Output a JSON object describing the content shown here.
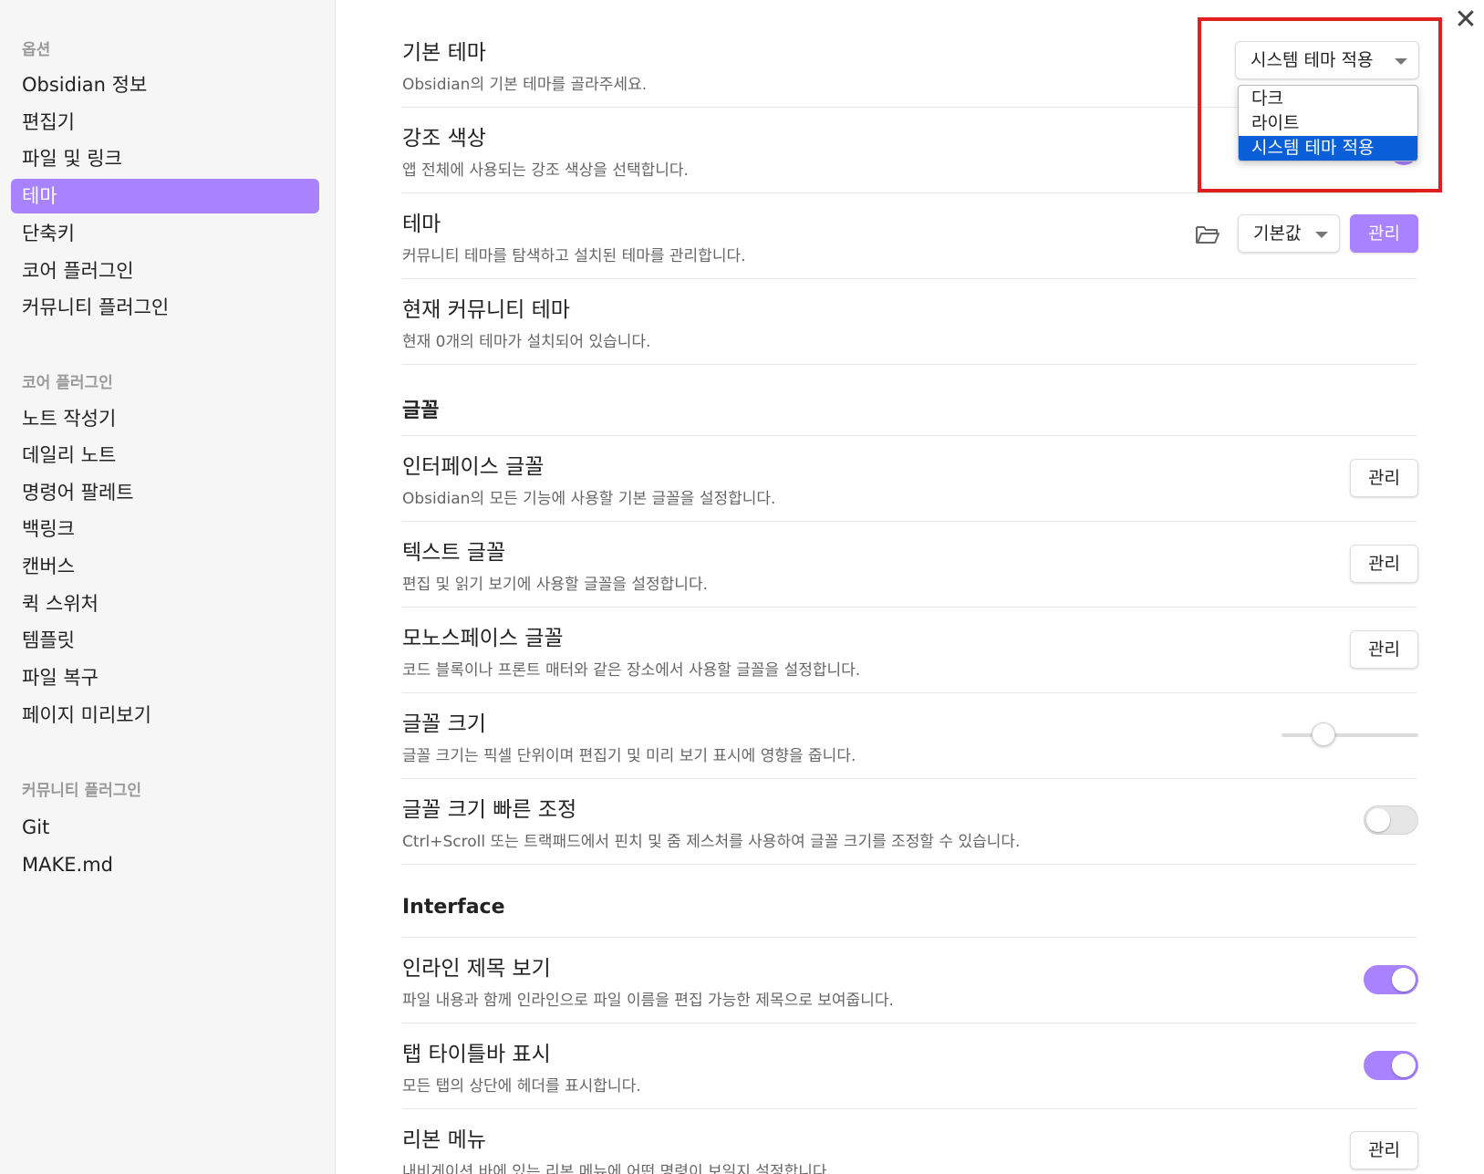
{
  "sidebar": {
    "options_heading": "옵션",
    "options_items": [
      {
        "label": "Obsidian 정보"
      },
      {
        "label": "편집기"
      },
      {
        "label": "파일 및 링크"
      },
      {
        "label": "테마",
        "active": true
      },
      {
        "label": "단축키"
      },
      {
        "label": "코어 플러그인"
      },
      {
        "label": "커뮤니티 플러그인"
      }
    ],
    "core_heading": "코어 플러그인",
    "core_items": [
      {
        "label": "노트 작성기"
      },
      {
        "label": "데일리 노트"
      },
      {
        "label": "명령어 팔레트"
      },
      {
        "label": "백링크"
      },
      {
        "label": "캔버스"
      },
      {
        "label": "퀵 스위처"
      },
      {
        "label": "템플릿"
      },
      {
        "label": "파일 복구"
      },
      {
        "label": "페이지 미리보기"
      }
    ],
    "community_heading": "커뮤니티 플러그인",
    "community_items": [
      {
        "label": "Git"
      },
      {
        "label": "MAKE.md"
      }
    ]
  },
  "close_label": "✕",
  "settings": {
    "base_theme": {
      "name": "기본 테마",
      "desc": "Obsidian의 기본 테마를 골라주세요.",
      "value": "시스템 테마 적용",
      "options": [
        "다크",
        "라이트",
        "시스템 테마 적용"
      ]
    },
    "accent_color": {
      "name": "강조 색상",
      "desc": "앱 전체에 사용되는 강조 색상을 선택합니다.",
      "color": "#a882ff"
    },
    "theme": {
      "name": "테마",
      "desc": "커뮤니티 테마를 탐색하고 설치된 테마를 관리합니다.",
      "select_value": "기본값",
      "manage_label": "관리"
    },
    "current_theme": {
      "name": "현재 커뮤니티 테마",
      "desc": "현재 0개의 테마가 설치되어 있습니다."
    },
    "fonts_heading": "글꼴",
    "interface_font": {
      "name": "인터페이스 글꼴",
      "desc": "Obsidian의 모든 기능에 사용할 기본 글꼴을 설정합니다.",
      "button": "관리"
    },
    "text_font": {
      "name": "텍스트 글꼴",
      "desc": "편집 및 읽기 보기에 사용할 글꼴을 설정합니다.",
      "button": "관리"
    },
    "mono_font": {
      "name": "모노스페이스 글꼴",
      "desc": "코드 블록이나 프론트 매터와 같은 장소에서 사용할 글꼴을 설정합니다.",
      "button": "관리"
    },
    "font_size": {
      "name": "글꼴 크기",
      "desc": "글꼴 크기는 픽셀 단위이며 편집기 및 미리 보기 표시에 영향을 줍니다.",
      "slider_fraction": 0.3
    },
    "quick_font_size": {
      "name": "글꼴 크기 빠른 조정",
      "desc": "Ctrl+Scroll 또는 트랙패드에서 핀치 및 줌 제스처를 사용하여 글꼴 크기를 조정할 수 있습니다.",
      "enabled": false
    },
    "interface_heading": "Interface",
    "inline_title": {
      "name": "인라인 제목 보기",
      "desc": "파일 내용과 함께 인라인으로 파일 이름을 편집 가능한 제목으로 보여줍니다.",
      "enabled": true
    },
    "tab_title_bar": {
      "name": "탭 타이틀바 표시",
      "desc": "모든 탭의 상단에 헤더를 표시합니다.",
      "enabled": true
    },
    "ribbon_menu": {
      "name": "리본 메뉴",
      "desc": "내비게이션 바에 있는 리본 메뉴에 어떤 명령이 보일지 설정합니다",
      "button": "관리"
    }
  },
  "colors": {
    "accent": "#a882ff",
    "highlight_box": "#e0201e",
    "dropdown_selected": "#0a5ed7"
  },
  "icons": {
    "close": "close-icon",
    "folder": "folder-open-icon",
    "caret": "chevron-down-icon"
  }
}
